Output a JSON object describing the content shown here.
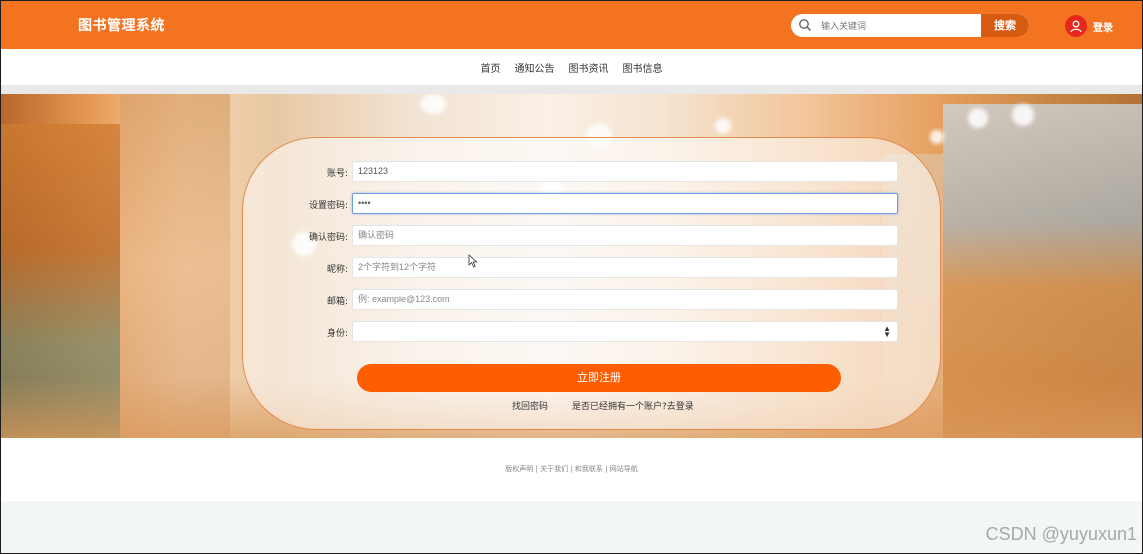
{
  "header": {
    "brand": "图书管理系统",
    "search_placeholder": "输入关键词",
    "search_button": "搜索",
    "login_label": "登录",
    "icons": {
      "search": "search-icon",
      "avatar": "user-icon"
    }
  },
  "nav": {
    "items": [
      {
        "label": "首页"
      },
      {
        "label": "通知公告"
      },
      {
        "label": "图书资讯"
      },
      {
        "label": "图书信息"
      }
    ]
  },
  "form": {
    "account_label": "账号:",
    "account_value": "123123",
    "password_label": "设置密码:",
    "password_value": "••••",
    "confirm_label": "确认密码:",
    "confirm_placeholder": "确认密码",
    "nickname_label": "昵称:",
    "nickname_placeholder": "2个字符到12个字符",
    "email_label": "邮箱:",
    "email_placeholder": "例: example@123.com",
    "role_label": "身份:",
    "role_value": "",
    "submit_label": "立即注册",
    "forgot_label": "找回密码",
    "login_link_label": "是否已经拥有一个账户?去登录"
  },
  "footer": {
    "links_text": "版权声明 | 关于我们 | 和我联系 | 网站导航"
  },
  "watermark": "CSDN @yuyuxun1",
  "colors": {
    "brand_orange": "#f47321",
    "button_orange": "#ff5e00",
    "search_button": "#d65a10"
  }
}
